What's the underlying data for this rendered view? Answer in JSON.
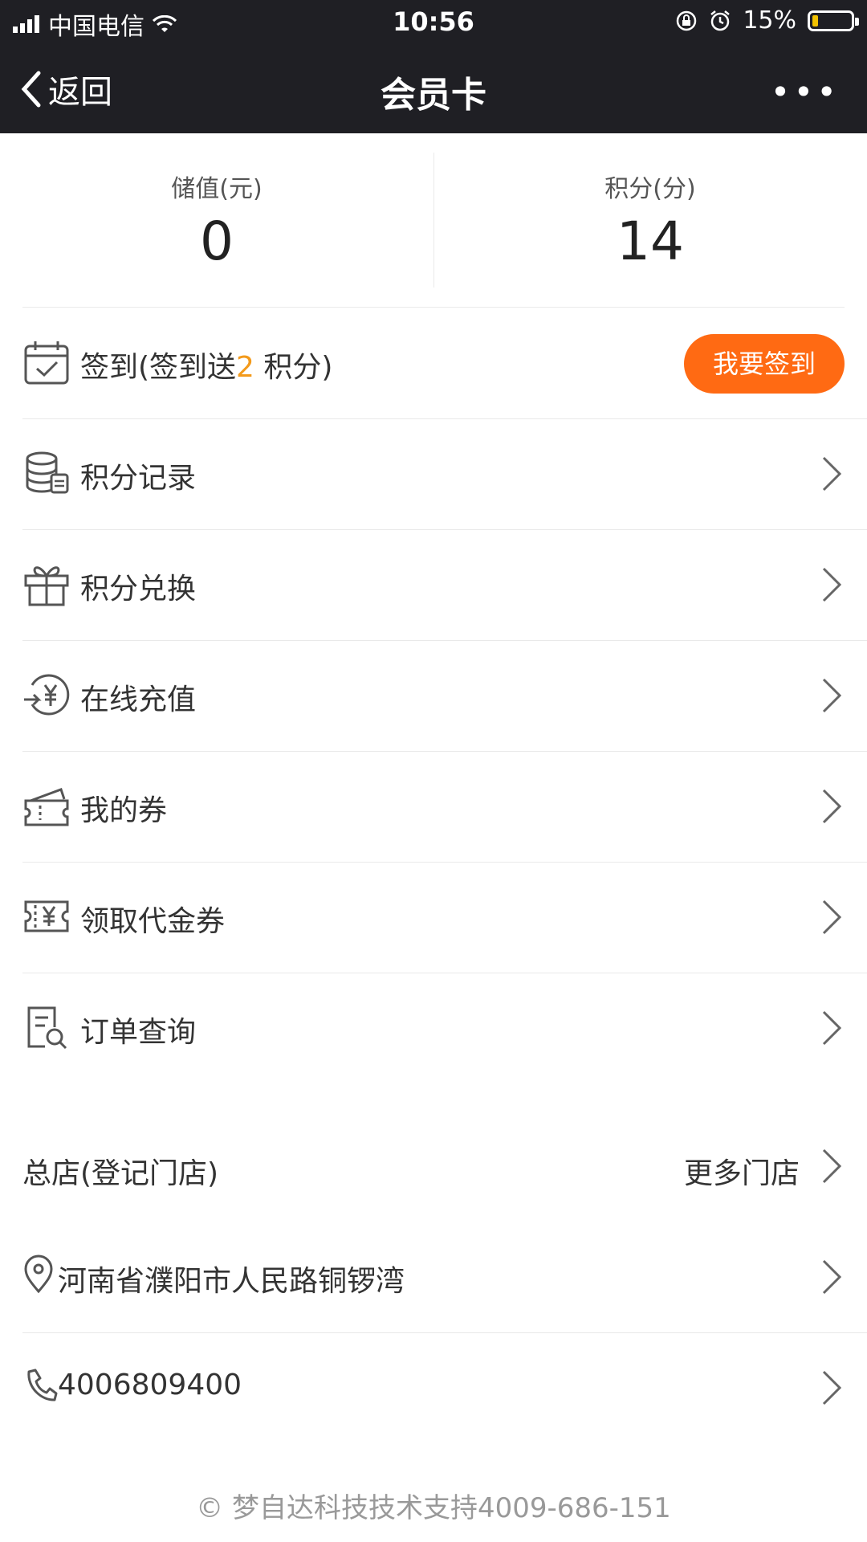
{
  "status_bar": {
    "carrier": "中国电信",
    "time": "10:56",
    "battery": "15%",
    "battery_level": 0.15
  },
  "nav": {
    "back_label": "返回",
    "title": "会员卡",
    "more_label": "•••"
  },
  "stats": [
    {
      "label": "储值(元)",
      "value": "0"
    },
    {
      "label": "积分(分)",
      "value": "14"
    }
  ],
  "checkin": {
    "label_pre": "签到(签到送",
    "points": "2",
    "label_post": " 积分)",
    "button": "我要签到"
  },
  "menu": [
    {
      "label": "积分记录",
      "icon": "database-icon"
    },
    {
      "label": "积分兑换",
      "icon": "gift-icon"
    },
    {
      "label": "在线充值",
      "icon": "yuan-recharge-icon"
    },
    {
      "label": "我的券",
      "icon": "ticket-icon"
    },
    {
      "label": "领取代金券",
      "icon": "voucher-icon"
    },
    {
      "label": "订单查询",
      "icon": "order-search-icon"
    }
  ],
  "store": {
    "title": "总店(登记门店)",
    "more": "更多门店"
  },
  "address": "河南省濮阳市人民路铜锣湾",
  "phone": "4006809400",
  "footer": "© 梦自达科技技术支持4009-686-151",
  "colors": {
    "nav_bg": "#1f1f24",
    "accent": "#ff6a13",
    "highlight": "#f39a1b"
  }
}
